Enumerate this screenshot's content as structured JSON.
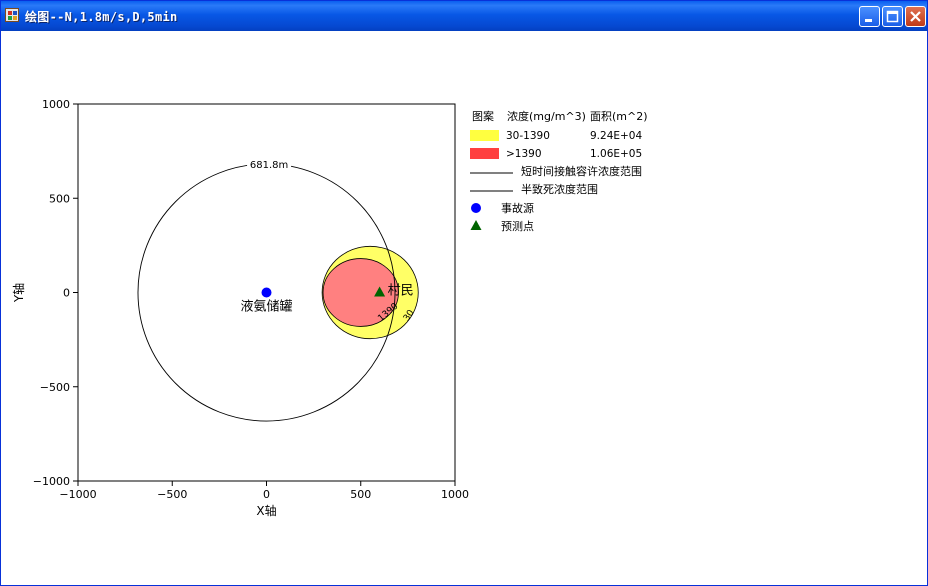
{
  "window": {
    "title": "绘图--N,1.8m/s,D,5min",
    "buttons": [
      "minimize",
      "maximize",
      "close"
    ]
  },
  "colors": {
    "yellow_zone": "#ffff66",
    "red_zone": "#ff8080",
    "source_marker": "#0000ff",
    "receptor_marker": "#006400",
    "titlebar": "#0a5ff0"
  },
  "chart_data": {
    "type": "scatter",
    "xlim": [
      -1000,
      1000
    ],
    "ylim": [
      -1000,
      1000
    ],
    "xlabel": "X轴",
    "ylabel": "Y轴",
    "x_ticks": [
      -1000,
      -500,
      0,
      500,
      1000
    ],
    "y_ticks": [
      1000,
      500,
      0,
      -500,
      -1000
    ],
    "x_tick_labels": [
      "−1000",
      "−500",
      "0",
      "500",
      "1000"
    ],
    "y_tick_labels": [
      "1000",
      "500",
      "0",
      "−500",
      "−1000"
    ],
    "grid": false,
    "circle": {
      "cx": 0,
      "cy": 0,
      "r": 681.8,
      "label": "681.8m"
    },
    "zone_30": {
      "cx": 550,
      "cy": 0,
      "rx": 255,
      "ry": 245,
      "contour_label": "30"
    },
    "zone_1390": {
      "cx": 500,
      "cy": 0,
      "rx": 200,
      "ry": 180,
      "contour_label": "1390"
    },
    "source": {
      "x": 0,
      "y": 0,
      "label": "液氨储罐"
    },
    "receptor": {
      "x": 600,
      "y": 0,
      "label": "村民"
    },
    "legend": {
      "placement": "right",
      "header": {
        "pattern": "图案",
        "concentration": "浓度(mg/m^3)",
        "area": "面积(m^2)"
      },
      "rows": [
        {
          "kind": "swatch",
          "color": "#ffff40",
          "range": "30-1390",
          "area": "9.24E+04"
        },
        {
          "kind": "swatch",
          "color": "#ff4040",
          "range": ">1390",
          "area": "1.06E+05"
        },
        {
          "kind": "line",
          "label": "短时间接触容许浓度范围"
        },
        {
          "kind": "line",
          "label": "半致死浓度范围"
        },
        {
          "kind": "dot",
          "color": "#0000ff",
          "label": "事故源"
        },
        {
          "kind": "triangle",
          "color": "#006400",
          "label": "预测点"
        }
      ]
    }
  }
}
